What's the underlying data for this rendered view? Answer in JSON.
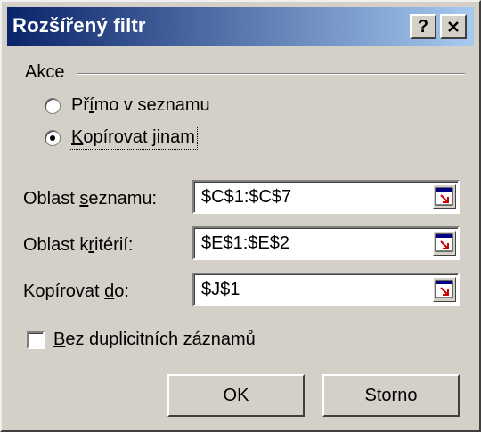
{
  "window": {
    "title": "Rozšířený filtr"
  },
  "title_buttons": {
    "help": "?",
    "close": "×"
  },
  "action_group": {
    "label": "Akce",
    "options": [
      {
        "before": "Př",
        "mnemonic": "í",
        "after": "mo v seznamu",
        "checked": false
      },
      {
        "before": "",
        "mnemonic": "K",
        "after": "opírovat jinam",
        "checked": true
      }
    ]
  },
  "fields": [
    {
      "label_before": "Oblast ",
      "label_mnemonic": "s",
      "label_after": "eznamu:",
      "value": "$C$1:$C$7"
    },
    {
      "label_before": "Oblast k",
      "label_mnemonic": "r",
      "label_after": "itérií:",
      "value": "$E$1:$E$2"
    },
    {
      "label_before": "Kopírovat ",
      "label_mnemonic": "d",
      "label_after": "o:",
      "value": "$J$1"
    }
  ],
  "checkbox": {
    "mnemonic": "B",
    "after": "ez duplicitních záznamů",
    "checked": false
  },
  "buttons": {
    "ok": "OK",
    "cancel": "Storno"
  },
  "colors": {
    "titlebar_start": "#0a246a",
    "titlebar_end": "#a6caf0",
    "face": "#d4d0c8",
    "ref_arrow": "#cc0000"
  }
}
